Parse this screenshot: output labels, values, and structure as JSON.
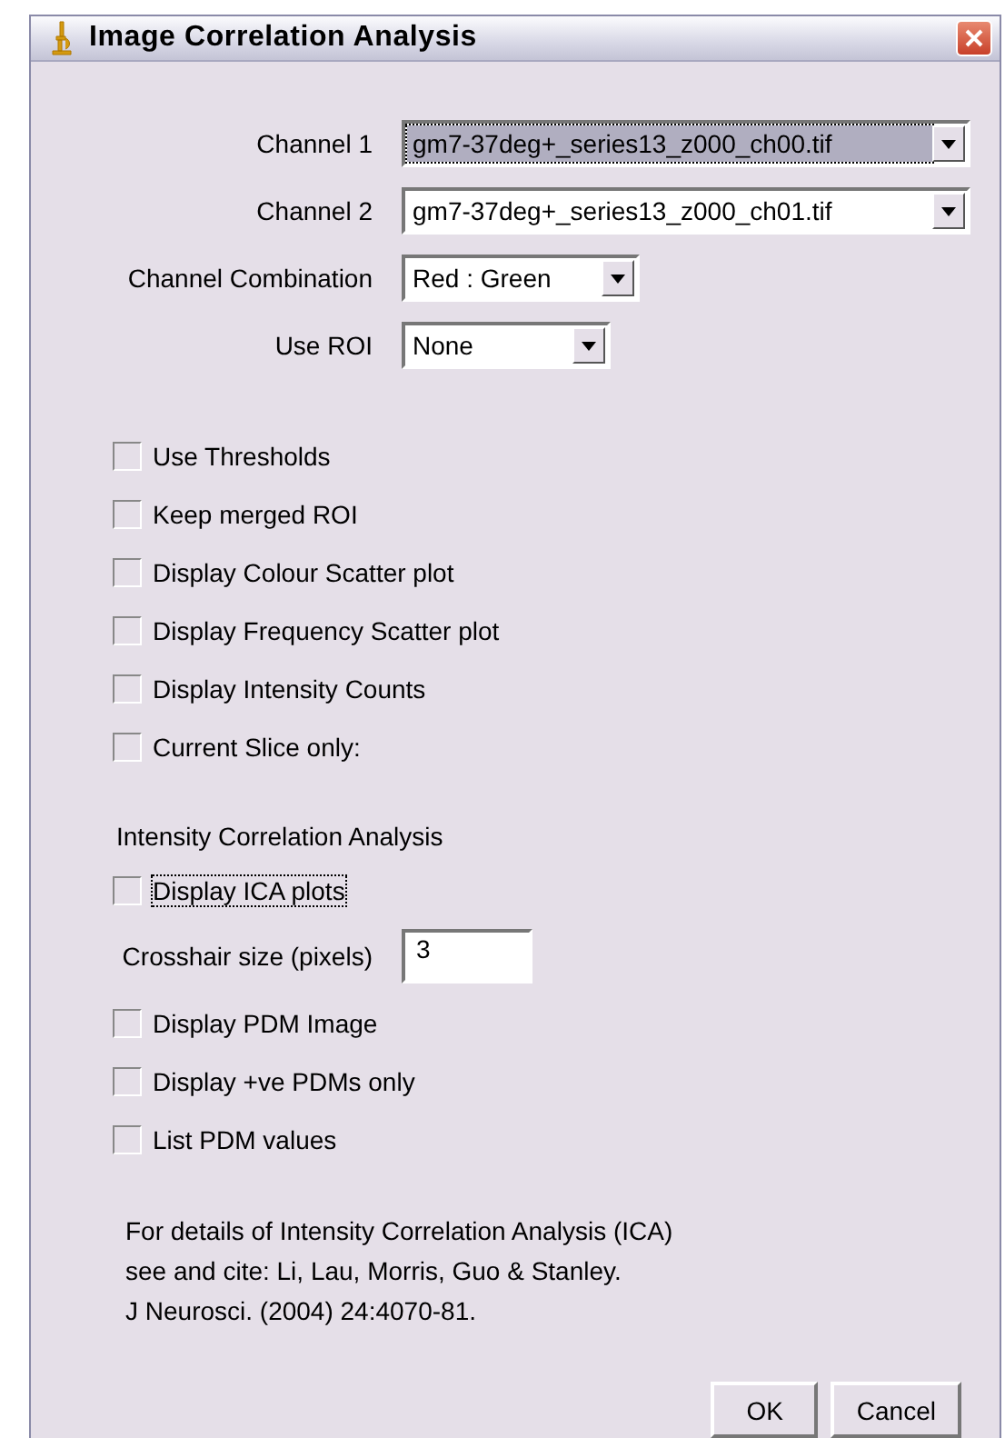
{
  "window": {
    "title": "Image Correlation Analysis"
  },
  "fields": [
    {
      "label": "Channel 1",
      "kind": "dropdown",
      "value": "gm7-37deg+_series13_z000_ch00.tif",
      "focused": true
    },
    {
      "label": "Channel 2",
      "kind": "dropdown",
      "value": "gm7-37deg+_series13_z000_ch01.tif",
      "focused": false
    },
    {
      "label": "Channel Combination",
      "kind": "dropdown",
      "value": "Red : Green",
      "focused": false
    },
    {
      "label": "Use ROI",
      "kind": "dropdown",
      "value": "None",
      "focused": false
    }
  ],
  "options": [
    {
      "label": "Use Thresholds",
      "checked": false
    },
    {
      "label": "Keep merged ROI",
      "checked": false
    },
    {
      "label": "Display Colour Scatter plot",
      "checked": false
    },
    {
      "label": "Display Frequency Scatter plot",
      "checked": false
    },
    {
      "label": "Display Intensity Counts",
      "checked": false
    },
    {
      "label": "Current Slice only:",
      "checked": false
    }
  ],
  "section_heading": "Intensity Correlation Analysis",
  "ica_options": [
    {
      "label": "Display ICA plots",
      "checked": false,
      "focused": true
    }
  ],
  "crosshair": {
    "label": "Crosshair size (pixels)",
    "value": "3"
  },
  "pdm_options": [
    {
      "label": "Display PDM Image",
      "checked": false
    },
    {
      "label": "Display +ve PDMs only",
      "checked": false
    },
    {
      "label": "List PDM values",
      "checked": false
    }
  ],
  "note": [
    "For details of Intensity Correlation Analysis (ICA)",
    "see and cite: Li, Lau, Morris, Guo & Stanley.",
    "J Neurosci. (2004) 24:4070-81."
  ],
  "buttons": [
    "OK",
    "Cancel"
  ]
}
